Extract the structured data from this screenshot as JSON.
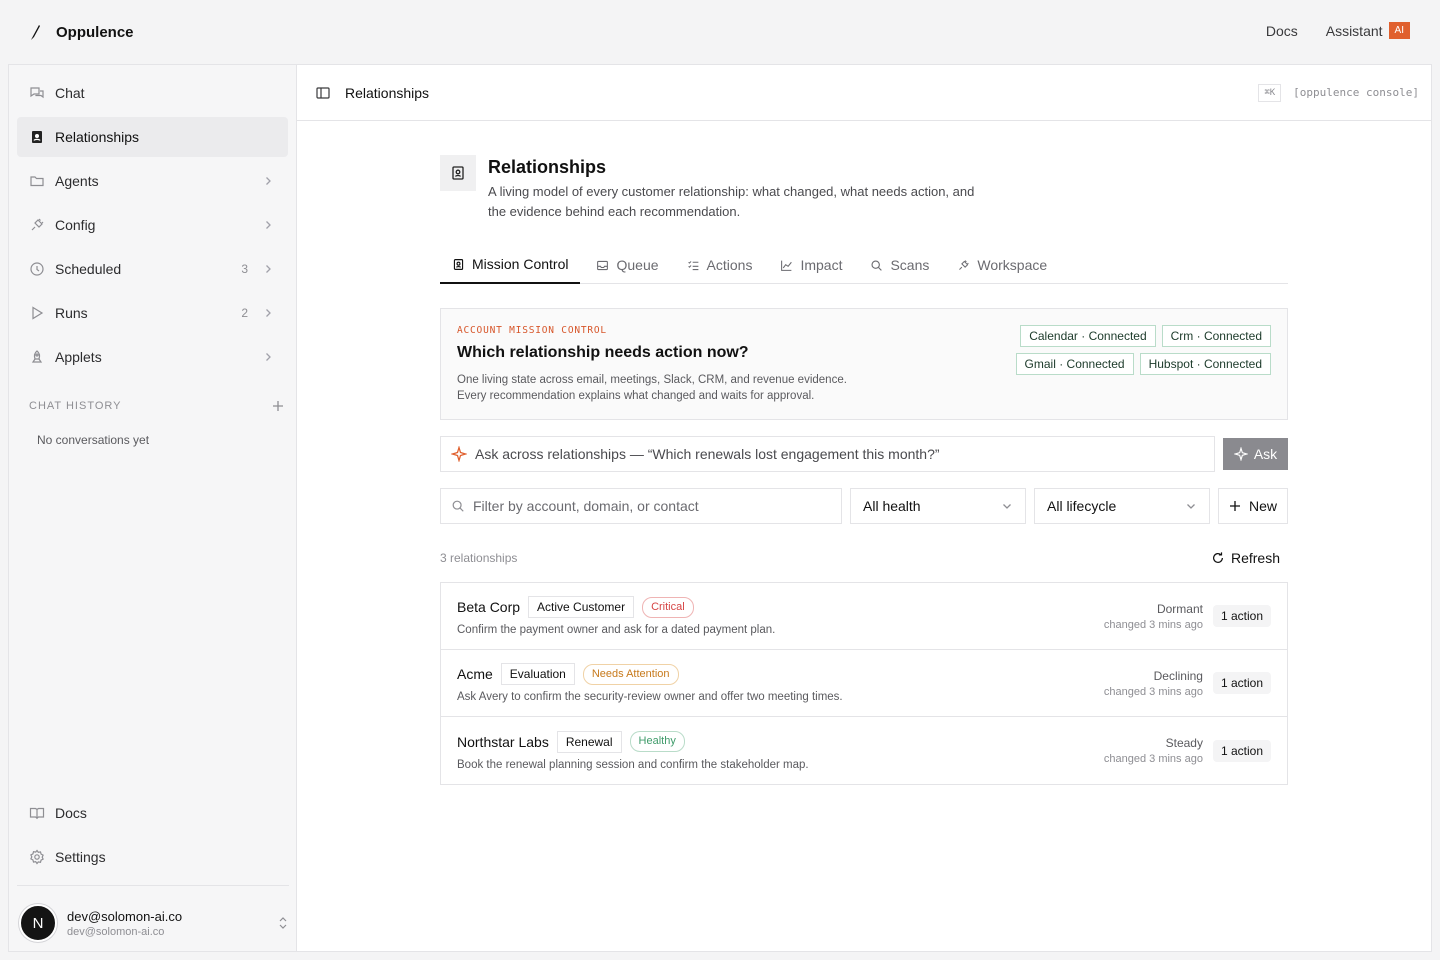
{
  "app": {
    "brand": "Oppulence",
    "top_links": {
      "docs": "Docs",
      "assistant": "Assistant",
      "ai_badge": "AI"
    }
  },
  "sidebar": {
    "items": [
      {
        "label": "Chat",
        "icon": "chat-icon",
        "count": "",
        "chevron": false
      },
      {
        "label": "Relationships",
        "icon": "contacts-book-icon",
        "count": "",
        "chevron": false,
        "active": true
      },
      {
        "label": "Agents",
        "icon": "folder-icon",
        "count": "",
        "chevron": true
      },
      {
        "label": "Config",
        "icon": "plug-icon",
        "count": "",
        "chevron": true
      },
      {
        "label": "Scheduled",
        "icon": "clock-icon",
        "count": "3",
        "chevron": true
      },
      {
        "label": "Runs",
        "icon": "play-icon",
        "count": "2",
        "chevron": true
      },
      {
        "label": "Applets",
        "icon": "rocket-icon",
        "count": "",
        "chevron": true
      }
    ],
    "history_title": "CHAT HISTORY",
    "history_empty": "No conversations yet",
    "bottom": [
      {
        "label": "Docs",
        "icon": "book-icon"
      },
      {
        "label": "Settings",
        "icon": "gear-icon"
      }
    ],
    "user": {
      "initial": "N",
      "email": "dev@solomon-ai.co",
      "sub": "dev@solomon-ai.co"
    }
  },
  "header": {
    "title": "Relationships",
    "shortcut": "⌘K",
    "console": "[oppulence console]"
  },
  "page": {
    "title": "Relationships",
    "description": "A living model of every customer relationship: what changed, what needs action, and the evidence behind each recommendation."
  },
  "tabs": [
    {
      "label": "Mission Control",
      "icon": "contacts-book-icon",
      "active": true
    },
    {
      "label": "Queue",
      "icon": "inbox-icon"
    },
    {
      "label": "Actions",
      "icon": "checklist-icon"
    },
    {
      "label": "Impact",
      "icon": "line-chart-icon"
    },
    {
      "label": "Scans",
      "icon": "search-icon"
    },
    {
      "label": "Workspace",
      "icon": "plug-icon"
    }
  ],
  "mission": {
    "eyebrow": "ACCOUNT MISSION CONTROL",
    "title": "Which relationship needs action now?",
    "desc_line1": "One living state across email, meetings, Slack, CRM, and revenue evidence.",
    "desc_line2": "Every recommendation explains what changed and waits for approval.",
    "connectors": [
      "Calendar · Connected",
      "Crm · Connected",
      "Gmail · Connected",
      "Hubspot · Connected"
    ]
  },
  "ask": {
    "placeholder": "Ask across relationships — “Which renewals lost engagement this month?”",
    "button": "Ask"
  },
  "filters": {
    "search_placeholder": "Filter by account, domain, or contact",
    "health": "All health",
    "lifecycle": "All lifecycle",
    "new_label": "New"
  },
  "list": {
    "count": "3 relationships",
    "refresh": "Refresh",
    "rows": [
      {
        "name": "Beta Corp",
        "stage": "Active Customer",
        "health": "Critical",
        "health_color": "#d64545",
        "health_border": "#efb4b4",
        "desc": "Confirm the payment owner and ask for a dated payment plan.",
        "trend": "Dormant",
        "changed": "changed 3 mins ago",
        "actions": "1 action"
      },
      {
        "name": "Acme",
        "stage": "Evaluation",
        "health": "Needs Attention",
        "health_color": "#c77a1c",
        "health_border": "#f0d2a6",
        "desc": "Ask Avery to confirm the security-review owner and offer two meeting times.",
        "trend": "Declining",
        "changed": "changed 3 mins ago",
        "actions": "1 action"
      },
      {
        "name": "Northstar Labs",
        "stage": "Renewal",
        "health": "Healthy",
        "health_color": "#3f9b6a",
        "health_border": "#b9dcc9",
        "desc": "Book the renewal planning session and confirm the stakeholder map.",
        "trend": "Steady",
        "changed": "changed 3 mins ago",
        "actions": "1 action"
      }
    ]
  },
  "colors": {
    "accent": "#e0602e",
    "connected_border": "#b9dcc9"
  }
}
